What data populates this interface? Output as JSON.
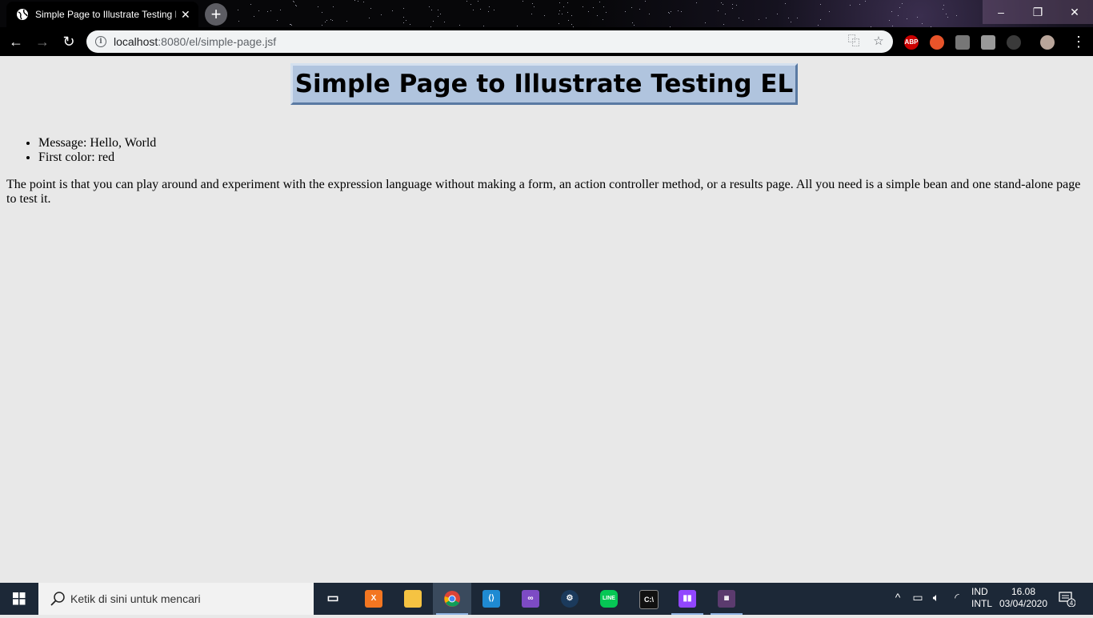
{
  "browser": {
    "tab_title": "Simple Page to Illustrate Testing EL",
    "url_host": "localhost",
    "url_path": ":8080/el/simple-page.jsf",
    "new_tab_symbol": "+",
    "close_symbol": "✕",
    "extensions": [
      "ABP"
    ]
  },
  "page": {
    "title": "Simple Page to Illustrate Testing EL",
    "items": [
      "Message: Hello, World",
      "First color: red"
    ],
    "paragraph": "The point is that you can play around and experiment with the expression language without making a form, an action controller method, or a results page. All you need is a simple bean and one stand-alone page to test it.",
    "title_background": "#b0c4de"
  },
  "taskbar": {
    "search_placeholder": "Ketik di sini untuk mencari",
    "lang_top": "IND",
    "lang_bottom": "INTL",
    "time": "16.08",
    "date": "03/04/2020",
    "notification_count": "4"
  }
}
